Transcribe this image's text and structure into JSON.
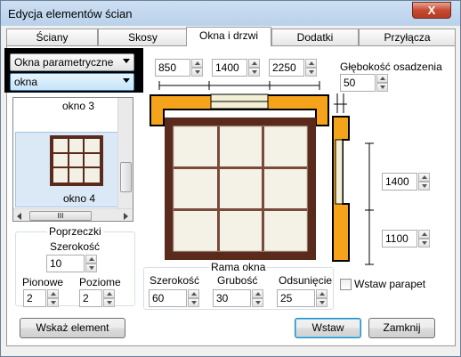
{
  "window": {
    "title": "Edycja elementów ścian",
    "close": "X"
  },
  "tabs": [
    {
      "label": "Ściany"
    },
    {
      "label": "Skosy"
    },
    {
      "label": "Okna i drzwi"
    },
    {
      "label": "Dodatki"
    },
    {
      "label": "Przyłącza"
    }
  ],
  "left": {
    "type_combo": "Okna parametryczne",
    "category_combo": "okna",
    "items": [
      {
        "label": "okno 3"
      },
      {
        "label": "okno 4"
      }
    ],
    "crossbars": {
      "legend": "Poprzeczki",
      "width_label": "Szerokość",
      "width_value": "10",
      "vertical_label": "Pionowe",
      "vertical_value": "2",
      "horizontal_label": "Poziome",
      "horizontal_value": "2"
    }
  },
  "dims": {
    "top": [
      "850",
      "1400",
      "2250"
    ],
    "depth_label": "Głębokość osadzenia",
    "depth_value": "50",
    "right_upper": "1400",
    "right_lower": "1100"
  },
  "frame": {
    "legend": "Rama okna",
    "width_label": "Szerokość",
    "width_value": "60",
    "thickness_label": "Grubość",
    "thickness_value": "30",
    "offset_label": "Odsunięcie",
    "offset_value": "25"
  },
  "sill": {
    "label": "Wstaw parapet",
    "checked": false
  },
  "buttons": {
    "show": "Wskaż element",
    "insert": "Wstaw",
    "close": "Zamknij"
  },
  "scrollbar": {
    "thumb": "III"
  },
  "colors": {
    "frame_orange": "#f5a31a",
    "frame_wood": "#5a2a1c",
    "highlight_black": "#000000"
  }
}
